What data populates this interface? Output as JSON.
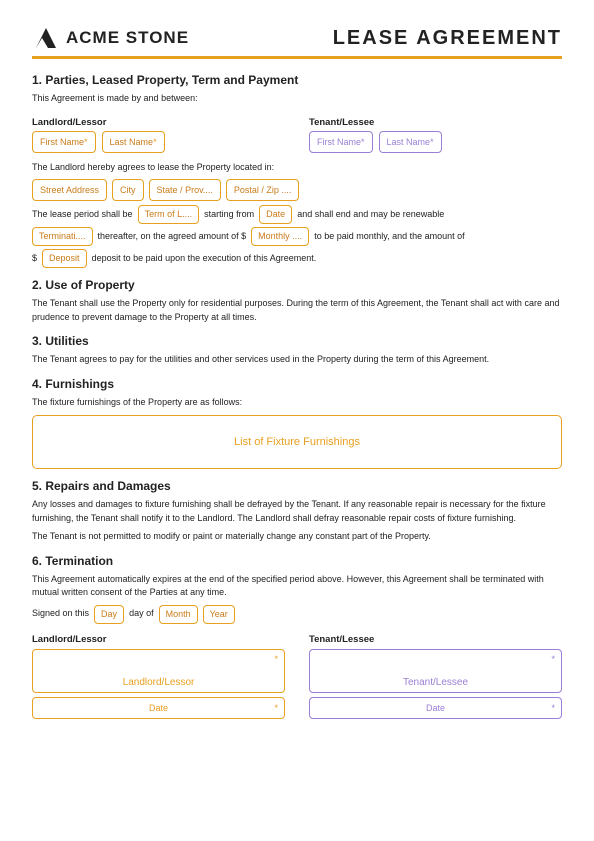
{
  "header": {
    "logo_text": "ACME STONE",
    "doc_title": "LEASE AGREEMENT"
  },
  "section1": {
    "title": "1. Parties, Leased Property, Term and Payment",
    "intro": "This Agreement is made by and between:",
    "landlord_label": "Landlord/Lessor",
    "tenant_label": "Tenant/Lessee",
    "landlord_first": "First Name",
    "landlord_last": "Last Name",
    "tenant_first": "First Name",
    "tenant_last": "Last Name",
    "address_intro": "The Landlord hereby agrees to lease the Property located in:",
    "street": "Street Address",
    "city": "City",
    "state": "State / Prov....",
    "postal": "Postal / Zip ....",
    "lease_text1": "The lease period shall be",
    "term_field": "Term of L....",
    "lease_text2": "starting from",
    "date_field": "Date",
    "lease_text3": "and shall end and may be renewable",
    "termination_field": "Terminati....",
    "lease_text4": "thereafter, on the agreed amount of $",
    "monthly_field": "Monthly ....",
    "lease_text5": "to be paid monthly, and the amount of",
    "deposit_label": "$",
    "deposit_field": "Deposit",
    "lease_text6": "deposit to be paid upon the execution of this Agreement."
  },
  "section2": {
    "title": "2. Use of Property",
    "body": "The Tenant shall use the Property only for residential purposes. During the term of this Agreement, the Tenant shall act with care and prudence to prevent damage to the Property at all times."
  },
  "section3": {
    "title": "3. Utilities",
    "body": "The Tenant agrees to pay for the utilities and other services used in the Property during the term of this Agreement."
  },
  "section4": {
    "title": "4. Furnishings",
    "body": "The fixture furnishings of the Property are as follows:",
    "placeholder": "List of Fixture Furnishings"
  },
  "section5": {
    "title": "5. Repairs and Damages",
    "body1": "Any losses and damages to fixture furnishing shall be defrayed by the Tenant. If any reasonable repair is necessary for the fixture furnishing, the Tenant shall notify it to the Landlord. The Landlord shall defray reasonable repair costs of fixture furnishing.",
    "body2": "The Tenant is not permitted to modify or paint or materially change any constant part of the Property."
  },
  "section6": {
    "title": "6. Termination",
    "body": "This Agreement automatically expires at the end of the specified period above. However, this Agreement shall be terminated with mutual written consent of the Parties at any time.",
    "signed_text1": "Signed on this",
    "day_field": "Day",
    "signed_text2": "day of",
    "month_field": "Month",
    "year_field": "Year"
  },
  "signature": {
    "landlord_label": "Landlord/Lessor",
    "tenant_label": "Tenant/Lessee",
    "landlord_placeholder": "Landlord/Lessor",
    "tenant_placeholder": "Tenant/Lessee",
    "date_placeholder": "Date"
  }
}
